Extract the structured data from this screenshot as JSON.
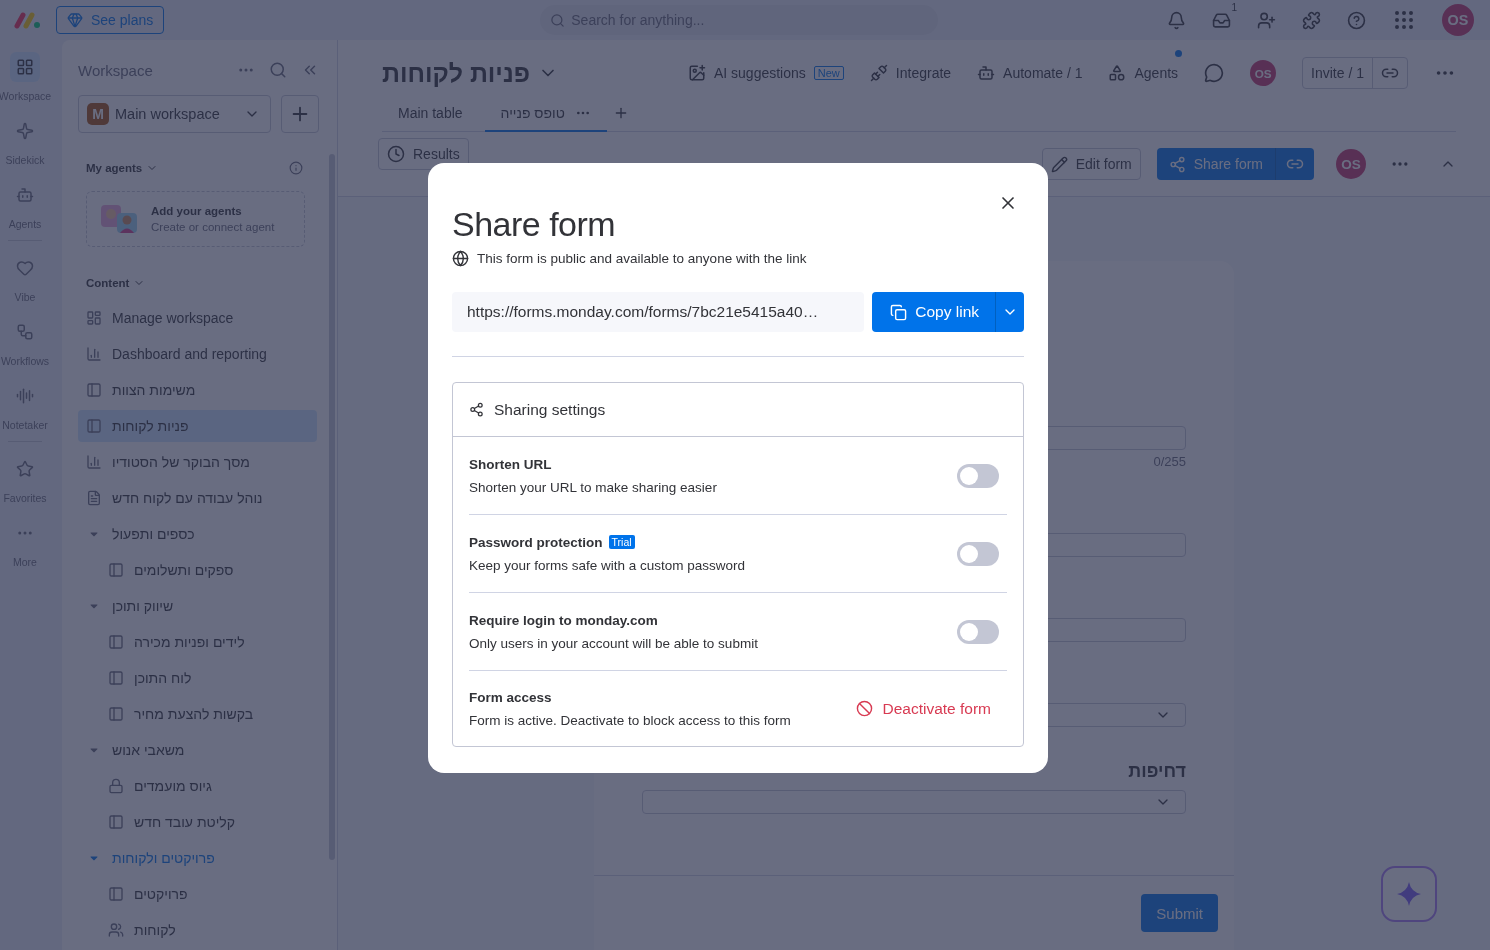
{
  "top_bar": {
    "plans_button": "See plans",
    "search": {
      "placeholder": "Search for anything..."
    },
    "inbox_count": "1",
    "avatar": "OS"
  },
  "rail": [
    {
      "label": "Workspace",
      "kind": "workspace",
      "selected": true
    },
    {
      "label": "Sidekick",
      "kind": "sidekick",
      "selected": false
    },
    {
      "label": "Agents",
      "kind": "agents",
      "selected": false
    },
    {
      "label": "Vibe",
      "kind": "vibe",
      "selected": false
    },
    {
      "label": "Workflows",
      "kind": "workflows",
      "selected": false
    },
    {
      "label": "Notetaker",
      "kind": "notetaker",
      "selected": false
    },
    {
      "label": "Favorites",
      "kind": "favorites",
      "selected": false
    },
    {
      "label": "More",
      "kind": "more",
      "selected": false
    }
  ],
  "sidebar": {
    "title": "Workspace",
    "workspace": {
      "initial": "M",
      "name": "Main workspace"
    },
    "agents_heading": "My agents",
    "agent_card": {
      "title": "Add your agents",
      "subtitle": "Create or connect agent"
    },
    "content_heading": "Content",
    "items": [
      {
        "label": "Manage workspace",
        "kind": "manage",
        "selected": false
      },
      {
        "label": "Dashboard and reporting",
        "kind": "dashboard",
        "selected": false
      },
      {
        "label": "משימות הצוות",
        "kind": "board",
        "selected": false
      },
      {
        "label": "פניות לקוחות",
        "kind": "board",
        "selected": true
      },
      {
        "label": "מסך הבוקר של הסטודיו",
        "kind": "dashboard",
        "selected": false
      },
      {
        "label": "נוהל עבודה עם לקוח חדש",
        "kind": "doc",
        "selected": false
      },
      {
        "label": "כספים ותפעול",
        "kind": "folder",
        "expanded": true,
        "highlighted": false,
        "children": [
          {
            "label": "ספקים ותשלומים",
            "kind": "board",
            "selected": false
          }
        ]
      },
      {
        "label": "שיווק ותוכן",
        "kind": "folder",
        "expanded": true,
        "highlighted": false,
        "children": [
          {
            "label": "לידים ופניות מכירה",
            "kind": "board",
            "selected": false
          },
          {
            "label": "לוח התוכן",
            "kind": "board",
            "selected": false
          },
          {
            "label": "בקשות להצעת מחיר",
            "kind": "board",
            "selected": false
          }
        ]
      },
      {
        "label": "משאבי אנוש",
        "kind": "folder",
        "expanded": true,
        "highlighted": false,
        "children": [
          {
            "label": "גיוס מועמדים",
            "kind": "locked",
            "selected": false
          },
          {
            "label": "קליטת עובד חדש",
            "kind": "board",
            "selected": false
          }
        ]
      },
      {
        "label": "פרויקטים ולקוחות",
        "kind": "folder",
        "expanded": true,
        "highlighted": true,
        "children": [
          {
            "label": "פרויקטים",
            "kind": "board",
            "selected": false
          },
          {
            "label": "לקוחות",
            "kind": "shared",
            "selected": false
          }
        ]
      }
    ]
  },
  "board": {
    "title": "פניות לקוחות",
    "actions": [
      {
        "kind": "ai",
        "label": "AI suggestions",
        "badge": "New",
        "notification": false
      },
      {
        "kind": "integrate",
        "label": "Integrate",
        "notification": false
      },
      {
        "kind": "automate",
        "label": "Automate / 1",
        "notification": false
      },
      {
        "kind": "agents",
        "label": "Agents",
        "notification": true
      }
    ],
    "avatar": "OS",
    "invite": "Invite / 1",
    "tabs": [
      {
        "label": "Main table",
        "selected": false
      },
      {
        "label": "טופס פנייה",
        "selected": true
      }
    ],
    "toolbar": {
      "results": "Results",
      "edit": "Edit form",
      "share": "Share form",
      "avatar": "OS"
    }
  },
  "form": {
    "fields": [
      {
        "kind": "text",
        "counter": "0/255"
      },
      {
        "kind": "text"
      },
      {
        "kind": "text"
      },
      {
        "kind": "select"
      },
      {
        "kind": "select",
        "label": "דחיפות"
      }
    ],
    "submit": "Submit"
  },
  "dialog": {
    "title": "Share form",
    "subtitle": "This form is public and available to anyone with the link",
    "url": "https://forms.monday.com/forms/7bc21e5415a40…",
    "copy_button": "Copy link",
    "settings_title": "Sharing settings",
    "rows": [
      {
        "kind": "toggle",
        "title": "Shorten URL",
        "description": "Shorten your URL to make sharing easier",
        "on": false
      },
      {
        "kind": "toggle",
        "title": "Password protection",
        "badge": "Trial",
        "description": "Keep your forms safe with a custom password",
        "on": false
      },
      {
        "kind": "toggle",
        "title": "Require login to monday.com",
        "description": "Only users in your account will be able to submit",
        "on": false
      },
      {
        "kind": "action",
        "title": "Form access",
        "description": "Form is active. Deactivate to block access to this form",
        "action": "Deactivate form"
      }
    ]
  }
}
